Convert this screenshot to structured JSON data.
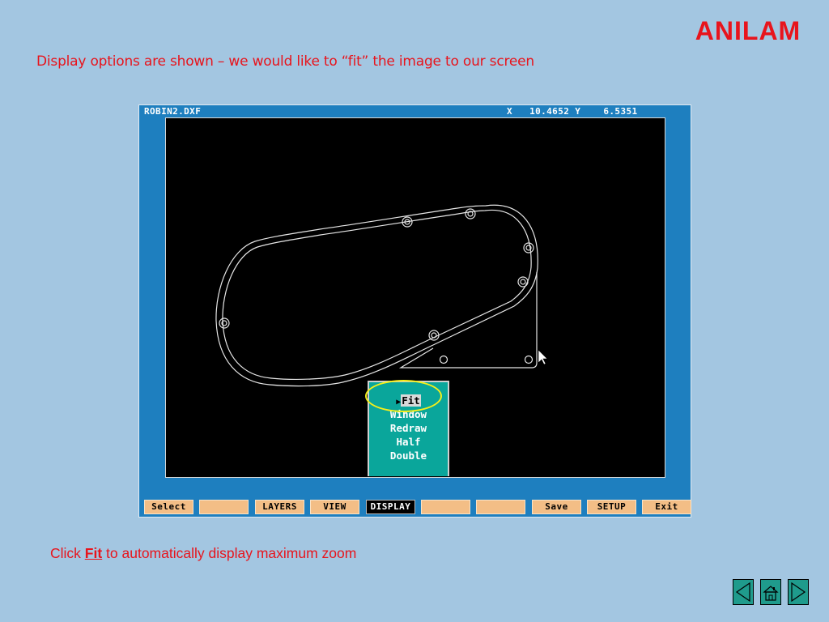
{
  "logo": {
    "text": "ANILAM",
    "color": "#e8141c"
  },
  "headline": "Display options are shown – we would like to “fit” the image to our screen",
  "cad_window": {
    "filename": "ROBIN2.DXF",
    "coords_text": "X   10.4652 Y    6.5351",
    "display_menu": {
      "items": [
        {
          "label": "Fit",
          "selected": true
        },
        {
          "label": "Window",
          "selected": false
        },
        {
          "label": "Redraw",
          "selected": false
        },
        {
          "label": "Half",
          "selected": false
        },
        {
          "label": "Double",
          "selected": false
        }
      ]
    },
    "function_keys": [
      {
        "label": "Select",
        "active": false
      },
      {
        "label": "",
        "active": false
      },
      {
        "label": "LAYERS",
        "active": false
      },
      {
        "label": "VIEW",
        "active": false
      },
      {
        "label": "DISPLAY",
        "active": true
      },
      {
        "label": "",
        "active": false
      },
      {
        "label": "",
        "active": false
      },
      {
        "label": "Save",
        "active": false
      },
      {
        "label": "SETUP",
        "active": false
      },
      {
        "label": "Exit",
        "active": false
      }
    ]
  },
  "caption": {
    "prefix": "Click ",
    "keyword": "Fit",
    "suffix": " to automatically display maximum zoom"
  },
  "navigation": {
    "back_icon": "left-triangle-icon",
    "home_icon": "home-icon",
    "forward_icon": "right-triangle-icon"
  },
  "colors": {
    "slide_background": "#a3c6e1",
    "accent_red": "#e8141c",
    "window_blue": "#1e7fbf",
    "menu_teal": "#0aa69b",
    "fkey_orange": "#f3be86",
    "highlight_yellow": "#f5ef1a"
  }
}
